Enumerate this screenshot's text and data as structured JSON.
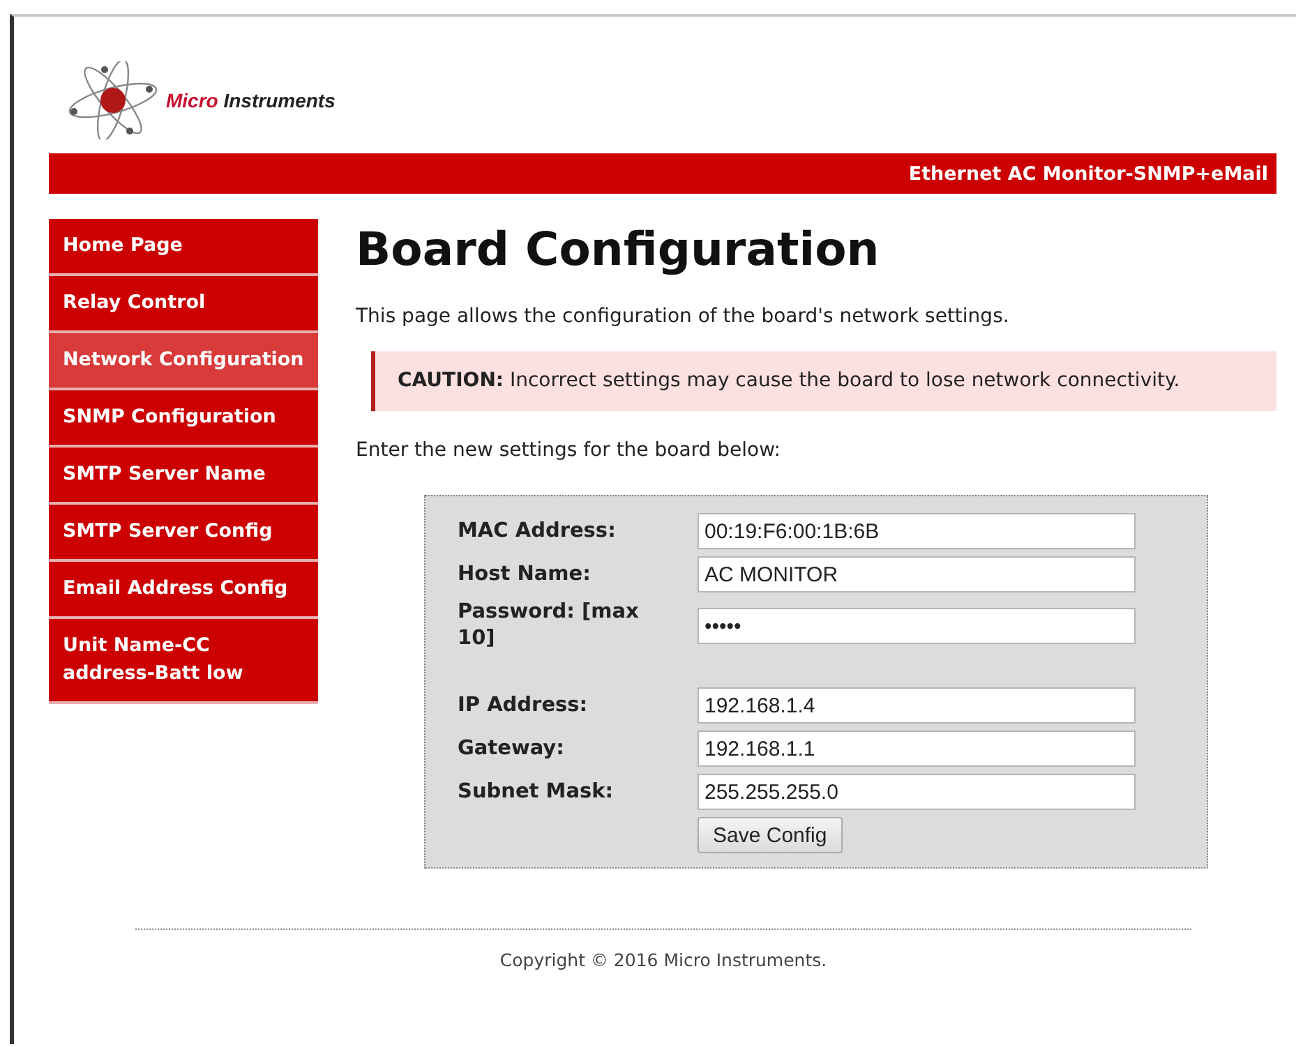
{
  "logo": {
    "brand_first": "Micro",
    "brand_second": "Instruments"
  },
  "banner": {
    "title": "Ethernet AC Monitor-SNMP+eMail"
  },
  "sidebar": {
    "items": [
      {
        "label": "Home Page",
        "selected": false
      },
      {
        "label": "Relay Control",
        "selected": false
      },
      {
        "label": "Network Configuration",
        "selected": true
      },
      {
        "label": "SNMP Configuration",
        "selected": false
      },
      {
        "label": "SMTP Server Name",
        "selected": false
      },
      {
        "label": "SMTP Server Config",
        "selected": false
      },
      {
        "label": "Email Address Config",
        "selected": false
      },
      {
        "label": "Unit Name-CC address-Batt low",
        "selected": false
      }
    ]
  },
  "main": {
    "title": "Board Configuration",
    "intro": "This page allows the configuration of the board's network settings.",
    "caution": "**CAUTION:** Incorrect settings may cause the board to lose network connectivity.",
    "prompt": "Enter the new settings for the board below:"
  },
  "form": {
    "fields": [
      {
        "label": "MAC Address:",
        "value": "00:19:F6:00:1B:6B"
      },
      {
        "label": "Host Name:",
        "value": "AC MONITOR"
      },
      {
        "label": "Password: [max 10]",
        "value": "•••••",
        "kind": "password"
      },
      {
        "label": "IP Address:",
        "value": "192.168.1.4"
      },
      {
        "label": "Gateway:",
        "value": "192.168.1.1"
      },
      {
        "label": "Subnet Mask:",
        "value": "255.255.255.0"
      }
    ],
    "button": "Save Config"
  },
  "footer": {
    "copyright": "Copyright © 2016 Micro Instruments."
  }
}
